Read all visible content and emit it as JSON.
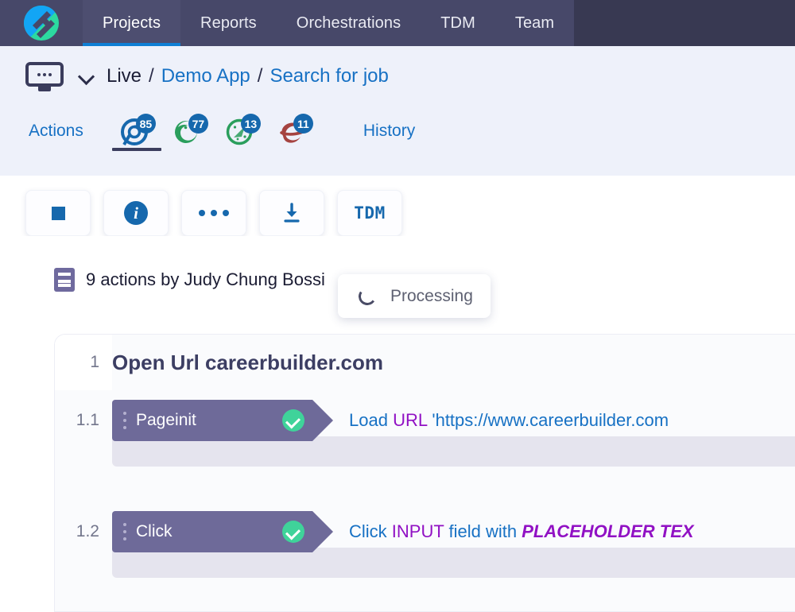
{
  "topnav": {
    "logo_name": "app-logo",
    "tabs": [
      {
        "label": "Projects",
        "active": true
      },
      {
        "label": "Reports",
        "active": false
      },
      {
        "label": "Orchestrations",
        "active": false
      },
      {
        "label": "TDM",
        "active": false
      },
      {
        "label": "Team",
        "active": false
      }
    ]
  },
  "breadcrumb": {
    "environment": "Live",
    "sep": "/",
    "project": "Demo App",
    "page": "Search for job"
  },
  "tabstrip": {
    "actions_label": "Actions",
    "history_label": "History",
    "browsers": [
      {
        "name": "chrome",
        "count": "85",
        "active": true
      },
      {
        "name": "firefox",
        "count": "77",
        "active": false
      },
      {
        "name": "opera",
        "count": "13",
        "active": false
      },
      {
        "name": "internet-explorer",
        "count": "11",
        "active": false
      }
    ]
  },
  "toolbar": {
    "stop_label": "",
    "info_label": "i",
    "more_label": "",
    "download_label": "",
    "tdm_label": "TDM"
  },
  "summary": {
    "actions_text": "9 actions by Judy Chung Bossi",
    "status_label": "Processing"
  },
  "steps": [
    {
      "number": "1",
      "title": "Open Url careerbuilder.com",
      "substeps": [
        {
          "number": "1.1",
          "chip": "Pageinit",
          "desc_parts": [
            {
              "text": "Load ",
              "style": "plain"
            },
            {
              "text": "URL",
              "style": "kw"
            },
            {
              "text": "  'https://www.careerbuilder.com",
              "style": "plain"
            }
          ]
        },
        {
          "number": "1.2",
          "chip": "Click",
          "desc_parts": [
            {
              "text": "Click ",
              "style": "plain"
            },
            {
              "text": "INPUT",
              "style": "kw"
            },
            {
              "text": "  field with ",
              "style": "plain"
            },
            {
              "text": "PLACEHOLDER TEX",
              "style": "kw-i"
            }
          ]
        }
      ]
    }
  ],
  "colors": {
    "nav_bg": "#383952",
    "nav_left_bg": "#474869",
    "accent_blue": "#1771c4",
    "band_bg": "#eef1fa",
    "chip_purple": "#6e6a99",
    "check_green": "#3fd39a",
    "keyword_purple": "#9111c4",
    "badge_blue": "#1668ad"
  }
}
